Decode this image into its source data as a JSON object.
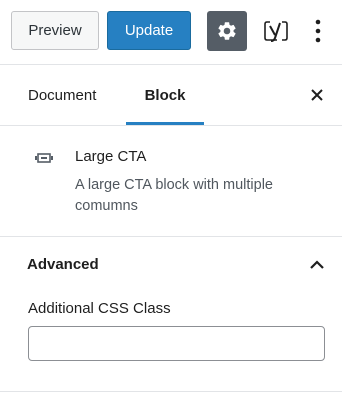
{
  "toolbar": {
    "preview_label": "Preview",
    "update_label": "Update",
    "icons": {
      "settings": "gear-icon",
      "yoast": "yoast-icon",
      "more": "more-vertical-icon"
    },
    "accent_color": "#2680c2",
    "settings_active_bg": "#555d66"
  },
  "sidebar": {
    "tabs": [
      {
        "label": "Document",
        "active": false
      },
      {
        "label": "Block",
        "active": true
      }
    ],
    "close_icon": "close-icon"
  },
  "block": {
    "icon": "cta-block-icon",
    "title": "Large CTA",
    "description": "A large CTA block with multiple comumns"
  },
  "advanced": {
    "title": "Advanced",
    "expanded": true,
    "toggle_icon": "chevron-up-icon",
    "css_class_label": "Additional CSS Class",
    "css_class_value": ""
  }
}
